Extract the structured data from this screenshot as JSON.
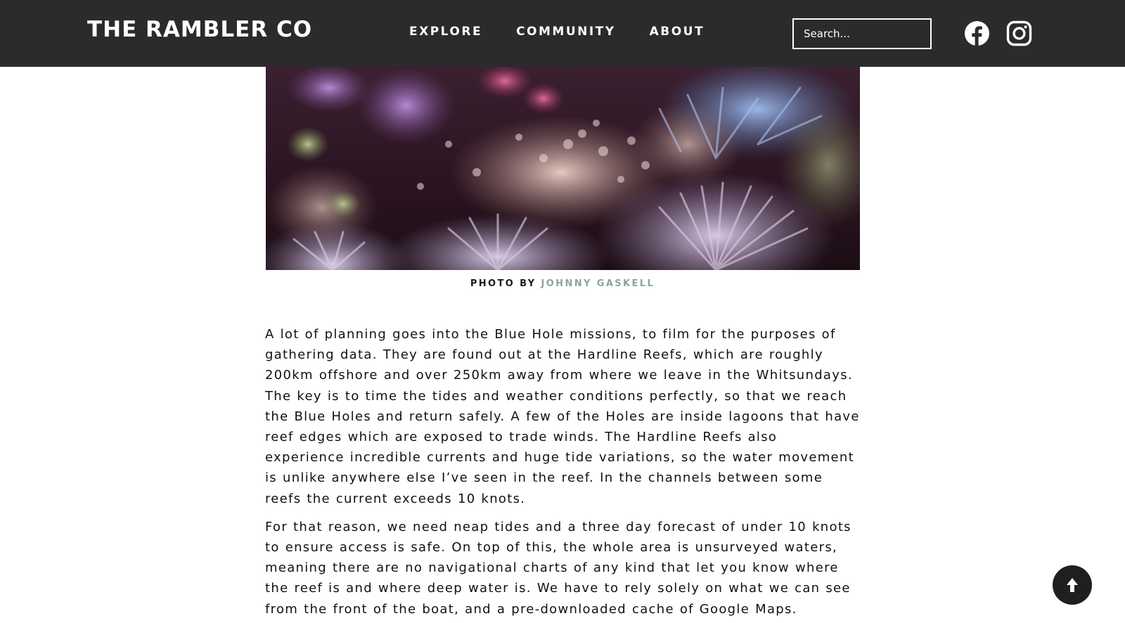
{
  "header": {
    "logo": "THE RAMBLER CO",
    "nav": [
      "EXPLORE",
      "COMMUNITY",
      "ABOUT"
    ],
    "search_placeholder": "Search...",
    "social": [
      "facebook-icon",
      "instagram-icon"
    ],
    "background_color": "#2b2b2b"
  },
  "photo": {
    "credit_prefix": "PHOTO BY",
    "credit_name": "JOHNNY GASKELL",
    "credit_color": "#8aa59a"
  },
  "article": {
    "paragraphs": [
      "A lot of planning goes into the Blue Hole missions, to film for the purposes of gathering data. They are found out at the Hardline Reefs, which are roughly 200km offshore and over 250km away from where we leave in the Whitsundays. The key is to time the tides and weather conditions perfectly, so that we reach the Blue Holes and return safely. A few of the Holes are inside lagoons that have reef edges which are exposed to trade winds. The Hardline Reefs also experience incredible currents and huge tide variations, so the water movement is unlike anywhere else I’ve seen in the reef. In the channels between some reefs the current exceeds 10 knots.",
      "For that reason, we need neap tides and a three day forecast of under 10 knots to ensure access is safe. On top of this, the whole area is unsurveyed waters, meaning there are no navigational charts of any kind that let you know where the reef is and where deep water is. We have to rely solely on what we can see from the front of the boat, and a pre-downloaded cache of Google Maps."
    ]
  },
  "scroll_top": {
    "icon": "arrow-up-icon"
  }
}
